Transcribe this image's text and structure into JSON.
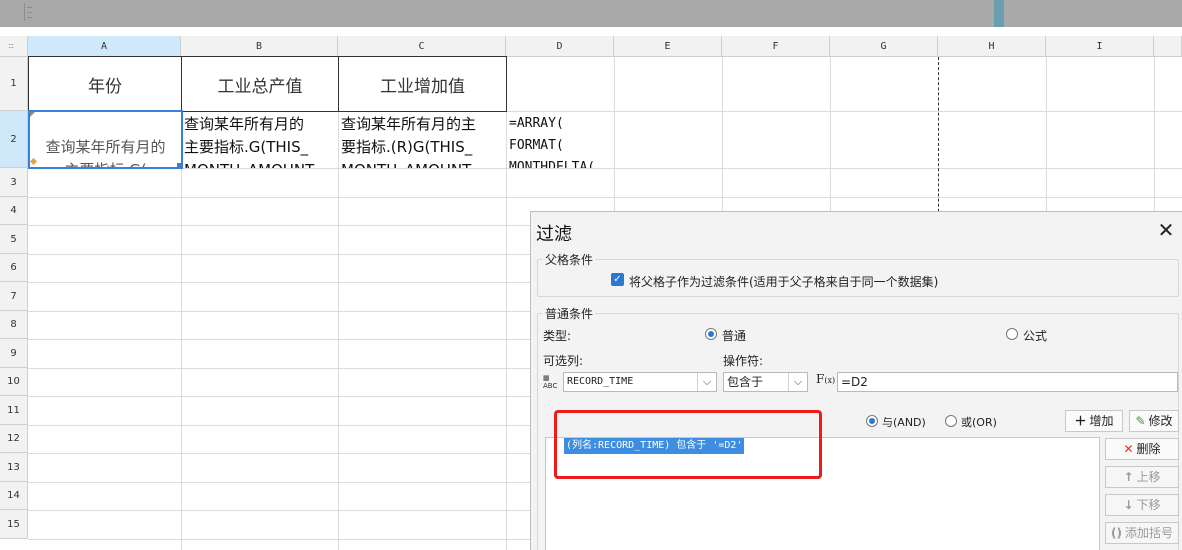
{
  "sheet": {
    "columns": [
      "A",
      "B",
      "C",
      "D",
      "E",
      "F",
      "G",
      "H",
      "I"
    ],
    "rows": [
      "1",
      "2",
      "3",
      "4",
      "5",
      "6",
      "7",
      "8",
      "9",
      "10",
      "11",
      "12",
      "13",
      "14",
      "15"
    ],
    "header_row": {
      "a1": "年份",
      "b1": "工业总产值",
      "c1": "工业增加值"
    },
    "data_row": {
      "a2": "查询某年所有月的\n主要指标.G(\nRECORD_TIME)",
      "b2": "查询某年所有月的\n主要指标.G(THIS_\nMONTH_AMOUNT",
      "c2": "查询某年所有月的主\n要指标.(R)G(THIS_\nMONTH_AMOUNT",
      "d2": "=ARRAY(\nFORMAT(\nMONTHDELTA("
    }
  },
  "dialog": {
    "title": "过滤",
    "parent_section": {
      "label": "父格条件",
      "checkbox_label": "将父格子作为过滤条件(适用于父子格来自于同一个数据集)",
      "checked": true
    },
    "normal_section": {
      "label": "普通条件",
      "type_label": "类型:",
      "type_normal": "普通",
      "type_formula": "公式",
      "selected_type": "普通",
      "column_label": "可选列:",
      "column_value": "RECORD_TIME",
      "operator_label": "操作符:",
      "operator_value": "包含于",
      "value_text": "=D2",
      "and_label": "与(AND)",
      "or_label": "或(OR)",
      "selected_logic": "与(AND)",
      "add_button": "增加",
      "modify_button": "修改",
      "delete_button": "删除",
      "up_button": "上移",
      "down_button": "下移",
      "bracket_button": "添加括号",
      "condition_item": "(列名:RECORD_TIME) 包含于 '=D2'"
    }
  },
  "colors": {
    "selection": "#3b7fd9",
    "highlight_box": "#ee1b1b",
    "accent": "#2b78d4"
  }
}
